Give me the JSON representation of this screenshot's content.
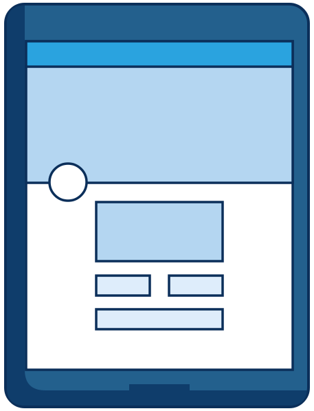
{
  "colors": {
    "outline": "#0b2f5a",
    "tablet_body": "#23608d",
    "tablet_shadow": "#0f3d6b",
    "top_bar": "#2aa3df",
    "banner": "#b4d6f1",
    "screen": "#ffffff",
    "content_block": "#b4d6f1",
    "small_block": "#deedfb",
    "avatar": "#ffffff"
  },
  "illustration": {
    "subject": "tablet-profile-page-wireframe",
    "device": "tablet",
    "icons": [
      "avatar-circle-icon",
      "home-button-icon"
    ]
  }
}
